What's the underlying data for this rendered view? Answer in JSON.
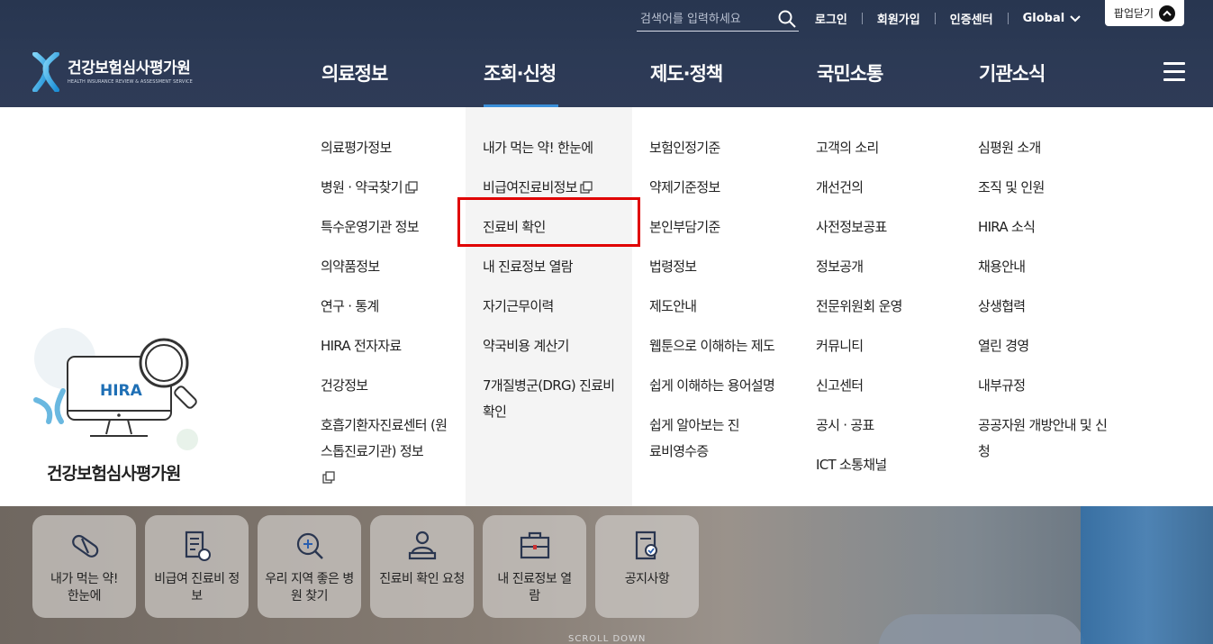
{
  "header": {
    "search": {
      "placeholder": "검색어를 입력하세요"
    },
    "utility_links": [
      "로그인",
      "회원가입",
      "인증센터"
    ],
    "global_label": "Global",
    "popup_label": "팝업닫기",
    "logo": {
      "name": "건강보험심사평가원",
      "english": "HEALTH INSURANCE REVIEW & ASSESSMENT SERVICE"
    },
    "nav": [
      "의료정보",
      "조회·신청",
      "제도·정책",
      "국민소통",
      "기관소식"
    ],
    "active_nav_index": 1
  },
  "mega_menu": {
    "illustration": {
      "badge": "HIRA",
      "title": "건강보험심사평가원"
    },
    "columns": [
      [
        "의료평가정보",
        "병원 · 약국찾기",
        "특수운영기관 정보",
        "의약품정보",
        "연구 · 통계",
        "HIRA 전자자료",
        "건강정보",
        "호흡기환자진료센터 (원스톱진료기관) 정보"
      ],
      [
        "내가 먹는 약! 한눈에",
        "비급여진료비정보",
        "진료비 확인",
        "내 진료정보 열람",
        "자기근무이력",
        "약국비용 계산기",
        "7개질병군(DRG) 진료비 확인"
      ],
      [
        "보험인정기준",
        "약제기준정보",
        "본인부담기준",
        "법령정보",
        "제도안내",
        "웹툰으로 이해하는 제도",
        "쉽게 이해하는 용어설명",
        "쉽게 알아보는 진료비영수증"
      ],
      [
        "고객의 소리",
        "개선건의",
        "사전정보공표",
        "정보공개",
        "전문위원회 운영",
        "커뮤니티",
        "신고센터",
        "공시 · 공표",
        "ICT 소통채널"
      ],
      [
        "심평원 소개",
        "조직 및 인원",
        "HIRA 소식",
        "채용안내",
        "상생협력",
        "열린 경영",
        "내부규정",
        "공공자원 개방안내 및 신청"
      ]
    ],
    "highlighted_item": "진료비 확인"
  },
  "quick_menu": [
    {
      "label": "내가 먹는 약! 한눈에",
      "icon": "pill-icon"
    },
    {
      "label": "비급여 진료비 정보",
      "icon": "document-won-icon"
    },
    {
      "label": "우리 지역 좋은 병원 찾기",
      "icon": "magnifier-plus-icon"
    },
    {
      "label": "진료비 확인 요청",
      "icon": "person-laptop-icon"
    },
    {
      "label": "내 진료정보 열람",
      "icon": "briefcase-icon"
    },
    {
      "label": "공지사항",
      "icon": "document-check-icon"
    }
  ],
  "scroll_label": "SCROLL DOWN",
  "colors": {
    "header_bg": "#2c3a55",
    "active_bar": "#3a8fd9",
    "highlight_box": "#e00000",
    "sub_col_bg": "#f4f4f4"
  }
}
